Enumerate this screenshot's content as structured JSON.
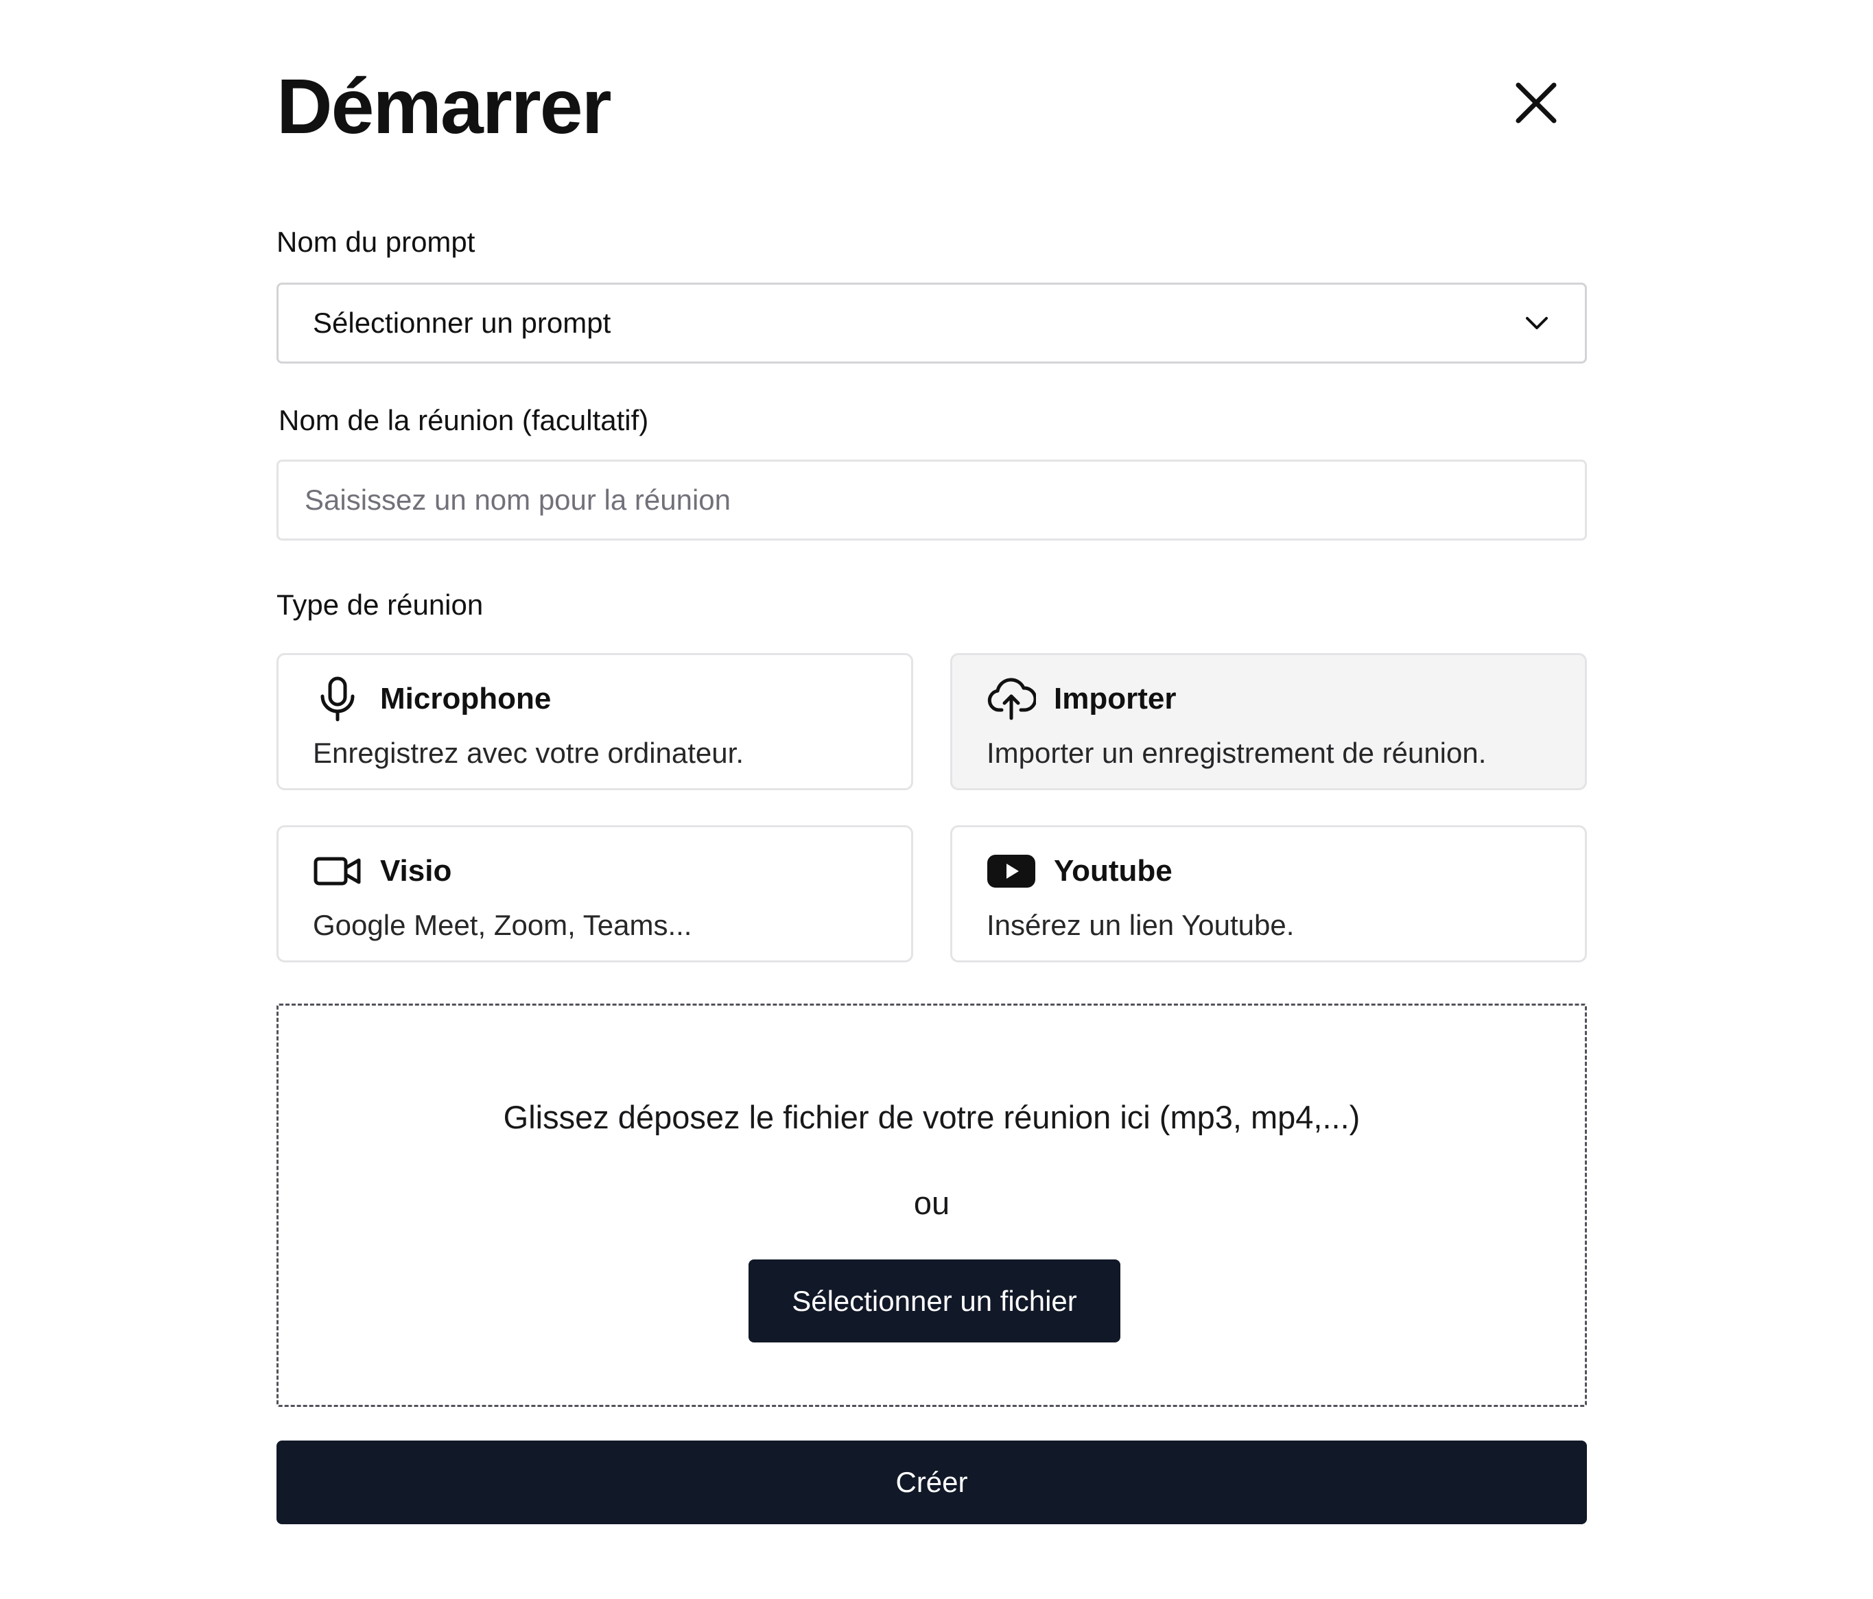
{
  "dialog": {
    "title": "Démarrer",
    "close_icon": "close-icon"
  },
  "prompt_field": {
    "label": "Nom du prompt",
    "selected_value": "Sélectionner un prompt",
    "icon": "chevron-down-icon"
  },
  "meeting_name_field": {
    "label": "Nom de la réunion (facultatif)",
    "value": "",
    "placeholder": "Saisissez un nom pour la réunion"
  },
  "meeting_type": {
    "label": "Type de réunion",
    "options": [
      {
        "title": "Microphone",
        "description": "Enregistrez avec votre ordinateur.",
        "icon": "microphone-icon",
        "selected": false
      },
      {
        "title": "Importer",
        "description": "Importer un enregistrement de réunion.",
        "icon": "cloud-upload-icon",
        "selected": true
      },
      {
        "title": "Visio",
        "description": "Google Meet, Zoom, Teams...",
        "icon": "video-camera-icon",
        "selected": false
      },
      {
        "title": "Youtube",
        "description": "Insérez un lien Youtube.",
        "icon": "youtube-icon",
        "selected": false
      }
    ]
  },
  "dropzone": {
    "text": "Glissez déposez le fichier de votre réunion ici (mp3, mp4,...)",
    "or_text": "ou",
    "button_label": "Sélectionner un fichier"
  },
  "actions": {
    "create_label": "Créer"
  },
  "colors": {
    "primary_dark": "#111827",
    "selected_card_bg": "#f4f4f5",
    "border": "#e4e4e7"
  }
}
